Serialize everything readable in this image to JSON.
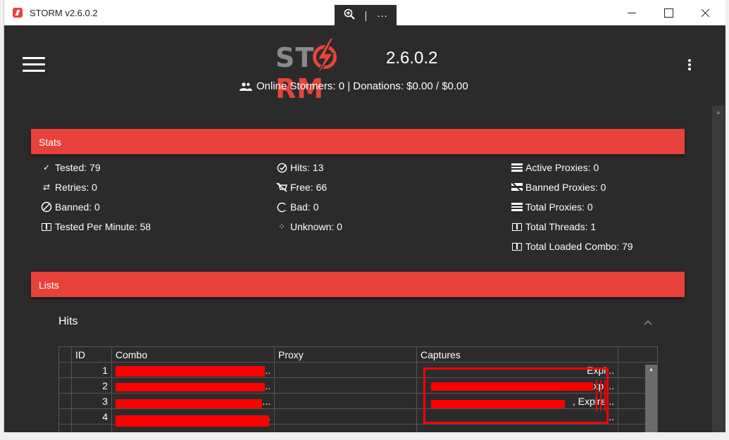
{
  "window": {
    "title": "STORM v2.6.0.2",
    "zoom_icon": "zoom-in-icon",
    "more_label": "···"
  },
  "header": {
    "logo_text_left": "ST",
    "logo_text_right": "RM",
    "version": "2.6.0.2",
    "online_text": "Online Stormers: 0 | Donations: $0.00 / $0.00",
    "accent_color": "#e8413a"
  },
  "stats": {
    "section_title": "Stats",
    "col1": [
      {
        "icon": "check-icon",
        "label": "Tested: 79"
      },
      {
        "icon": "retry-icon",
        "label": "Retries: 0"
      },
      {
        "icon": "banned-icon",
        "label": "Banned: 0"
      },
      {
        "icon": "counter-icon",
        "label": "Tested Per Minute: 58"
      }
    ],
    "col2": [
      {
        "icon": "hits-icon",
        "label": "Hits: 13"
      },
      {
        "icon": "free-icon",
        "label": "Free: 66"
      },
      {
        "icon": "bad-icon",
        "label": "Bad: 0"
      },
      {
        "icon": "unknown-icon",
        "label": "Unknown: 0"
      }
    ],
    "col3": [
      {
        "icon": "server-icon",
        "label": "Active Proxies: 0"
      },
      {
        "icon": "server-off-icon",
        "label": "Banned Proxies: 0"
      },
      {
        "icon": "server-icon",
        "label": "Total Proxies: 0"
      },
      {
        "icon": "counter-icon",
        "label": "Total Threads: 1"
      },
      {
        "icon": "counter-icon",
        "label": "Total Loaded Combo: 79"
      }
    ]
  },
  "lists": {
    "section_title": "Lists",
    "hits_title": "Hits",
    "columns": [
      "",
      "ID",
      "Combo",
      "Proxy",
      "Captures",
      ""
    ],
    "rows": [
      {
        "id": "1",
        "combo_tail": "...",
        "capture_tail": "Expi..."
      },
      {
        "id": "2",
        "combo_tail": "...",
        "capture_tail": "3, Expi..."
      },
      {
        "id": "3",
        "combo_tail": "...",
        "capture_tail": ", Expire..."
      },
      {
        "id": "4",
        "combo_tail": "...",
        "capture_tail": "..."
      }
    ]
  }
}
